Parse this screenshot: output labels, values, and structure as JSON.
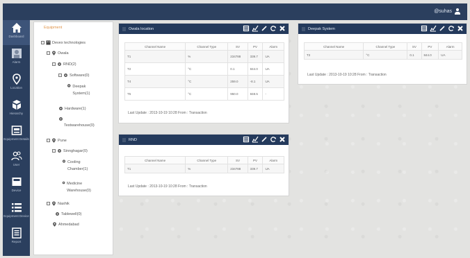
{
  "user": {
    "name": "@suhas"
  },
  "nav": [
    {
      "label": "Dashboard",
      "icon": "home-icon"
    },
    {
      "label": "Alarm",
      "icon": "alarm-icon"
    },
    {
      "label": "Location",
      "icon": "location-pin-icon"
    },
    {
      "label": "Hierarchy",
      "icon": "hierarchy-icon"
    },
    {
      "label": "Equipment Details",
      "icon": "equipment-icon"
    },
    {
      "label": "User",
      "icon": "users-icon"
    },
    {
      "label": "Device",
      "icon": "device-icon"
    },
    {
      "label": "Equipment Device",
      "icon": "list-icon"
    },
    {
      "label": "Report",
      "icon": "report-icon"
    }
  ],
  "tree": {
    "header": "Equipment",
    "nodes": [
      "Devex technologies",
      "Owala",
      "RND(2)",
      "Software(0)",
      "Deepak System(1)",
      "Hardware(1)",
      "Testwarehouse(0)",
      "Pune",
      "Sinnghagar(0)",
      "Cooling Chamber(1)",
      "Medicine Warehouse(0)",
      "Nashik",
      "Tablewell(0)",
      "Ahmedabad"
    ]
  },
  "widgets": {
    "owala": {
      "title": "Owala location",
      "columns": [
        "Channel Name",
        "Channel Type",
        "SV",
        "PV",
        "Alarm"
      ],
      "rows": [
        [
          "T1",
          "%",
          "234788",
          "339.7",
          "UA"
        ],
        [
          "T2",
          "°C",
          "0.1",
          "844.0",
          "UA"
        ],
        [
          "T4",
          "°C",
          "259.0",
          "-8.1",
          "UA"
        ],
        [
          "T5",
          "°C",
          "950.0",
          "848.5",
          "-"
        ]
      ],
      "footer": "Last Update : 2013-10-19 10:28    From : Transaction"
    },
    "deepak": {
      "title": "Deepak System",
      "columns": [
        "Channel Name",
        "Channel Type",
        "SV",
        "PV",
        "Alarm"
      ],
      "rows": [
        [
          "T2",
          "°C",
          "0.1",
          "844.0",
          "UA"
        ]
      ],
      "footer": "Last Update : 2013-10-19 10:28    From : Transaction"
    },
    "rnd": {
      "title": "RND",
      "columns": [
        "Channel Name",
        "Channel Type",
        "SV",
        "PV",
        "Alarm"
      ],
      "rows": [
        [
          "T1",
          "%",
          "234788",
          "339.7",
          "UA"
        ]
      ],
      "footer": "Last Update : 2013-10-19 10:28    From : Transaction"
    }
  },
  "colors": {
    "nav_bg": "#2b3f5e",
    "widget_header": "#243a5c",
    "tree_header": "#e0944a",
    "page_bg": "#e3e3e1"
  }
}
